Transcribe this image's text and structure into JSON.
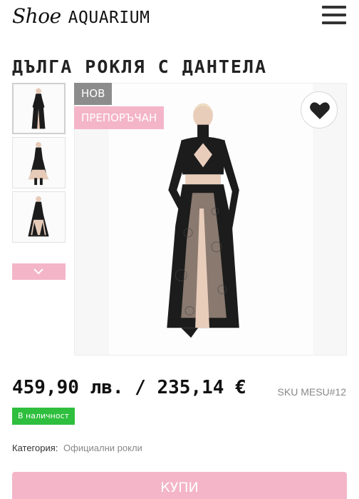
{
  "header": {
    "logo_script": "Shoe",
    "logo_caps": "AQUARIUM",
    "menu_icon": "hamburger-menu-icon"
  },
  "product": {
    "title": "ДЪЛГА РОКЛЯ С ДАНТЕЛА",
    "badges": {
      "new": "НОВ",
      "recommended": "ПРЕПОРЪЧАН"
    },
    "price": "459,90 лв. / 235,14 €",
    "sku": "SKU MESU#12",
    "stock": "В наличност",
    "category_label": "Категория:",
    "category_value": "Официални рокли",
    "buy_label": "КУПИ"
  },
  "gallery": {
    "thumbnails": [
      "thumbnail-1",
      "thumbnail-2",
      "thumbnail-3"
    ],
    "active_index": 0,
    "next_icon": "chevron-down-icon",
    "favorite_icon": "heart-icon"
  },
  "colors": {
    "pink": "#f4b5c9",
    "badge_gray": "#8c8c8c",
    "stock_green": "#2fbf3e",
    "text_dark": "#222222"
  }
}
